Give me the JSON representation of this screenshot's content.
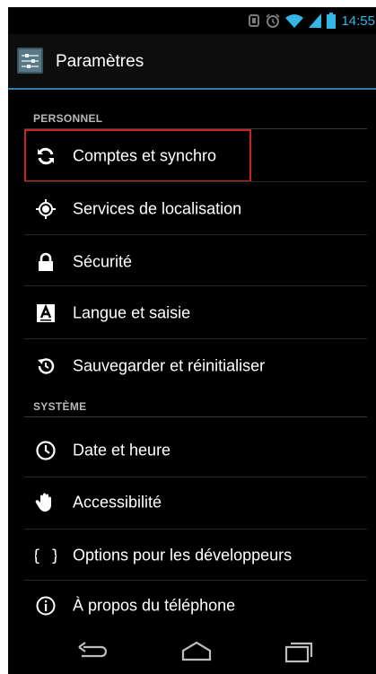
{
  "status_bar": {
    "time": "14:55"
  },
  "action_bar": {
    "title": "Paramètres"
  },
  "sections": [
    {
      "header": "PERSONNEL",
      "items": [
        {
          "label": "Comptes et synchro",
          "icon": "sync-icon"
        },
        {
          "label": "Services de localisation",
          "icon": "location-icon"
        },
        {
          "label": "Sécurité",
          "icon": "lock-icon"
        },
        {
          "label": "Langue et saisie",
          "icon": "language-icon"
        },
        {
          "label": "Sauvegarder et réinitialiser",
          "icon": "backup-icon"
        }
      ]
    },
    {
      "header": "SYSTÈME",
      "items": [
        {
          "label": "Date et heure",
          "icon": "clock-icon"
        },
        {
          "label": "Accessibilité",
          "icon": "hand-icon"
        },
        {
          "label": "Options pour les développeurs",
          "icon": "braces-icon"
        },
        {
          "label": "À propos du téléphone",
          "icon": "info-icon"
        }
      ]
    }
  ],
  "colors": {
    "accent": "#33b5e5",
    "highlight": "#c8231f",
    "background": "#000000"
  }
}
